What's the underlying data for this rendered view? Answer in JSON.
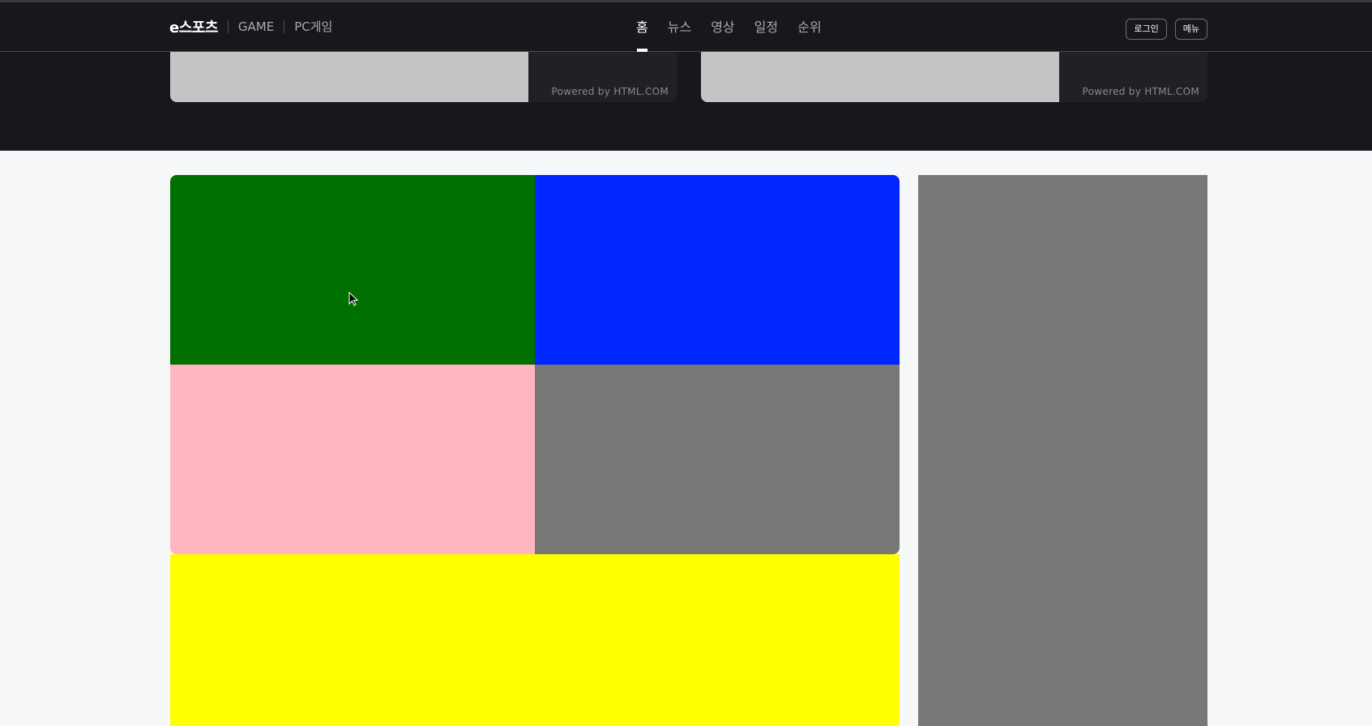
{
  "header": {
    "brand": "e스포츠",
    "links": [
      "GAME",
      "PC게임"
    ],
    "nav": [
      "홈",
      "뉴스",
      "영상",
      "일정",
      "순위"
    ],
    "active_nav": "홈",
    "login_label": "로그인",
    "menu_label": "메뉴"
  },
  "banner": {
    "ads": [
      {
        "credit": "Powered by HTML.COM"
      },
      {
        "credit": "Powered by HTML.COM"
      }
    ]
  },
  "colors": {
    "header_bg": "#17181b",
    "tile_green": "#007000",
    "tile_blue": "#0026ff",
    "tile_pink": "#ffb6c1",
    "tile_gray": "#777777",
    "block_yellow": "#ffff00",
    "side_gray": "#777777",
    "ad_placeholder": "#c4c4c4"
  },
  "icons": {
    "cursor": "arrow-cursor-icon"
  }
}
